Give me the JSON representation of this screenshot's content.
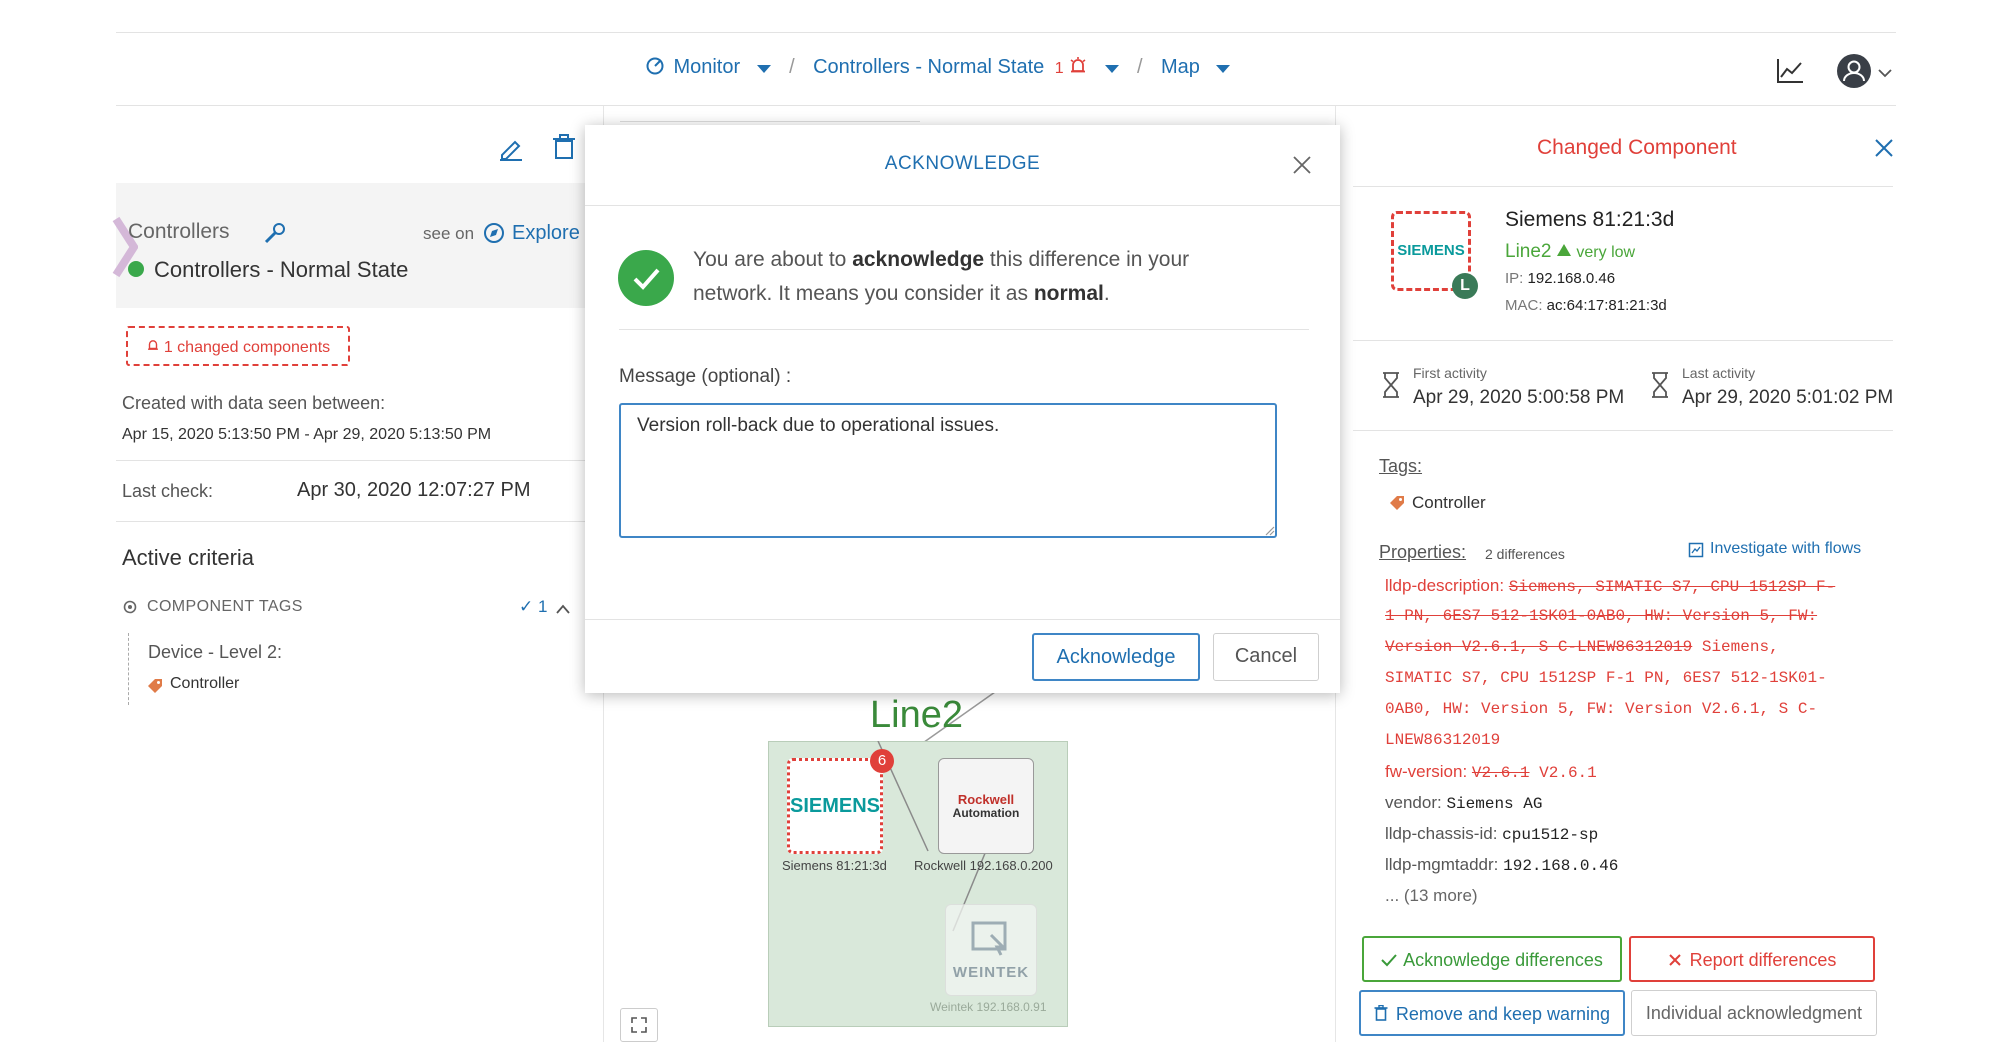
{
  "nav": {
    "monitor": "Monitor",
    "sep1": "/",
    "controllers": "Controllers - Normal State",
    "alert_count": "1",
    "sep2": "/",
    "map": "Map"
  },
  "left": {
    "group_label": "Controllers",
    "see_on": "see on",
    "explore": "Explore",
    "state_name": "Controllers - Normal State",
    "changed_badge": "1 changed components",
    "created_label": "Created with data seen between:",
    "created_range": "Apr 15, 2020 5:13:50 PM - Apr 29, 2020 5:13:50 PM",
    "last_check_label": "Last check:",
    "last_check_value": "Apr 30, 2020 12:07:27 PM",
    "active_criteria": "Active criteria",
    "component_tags": "COMPONENT TAGS",
    "tags_count": "✓ 1",
    "device_level": "Device - Level 2:",
    "tag": "Controller"
  },
  "modal": {
    "title": "ACKNOWLEDGE",
    "msg_pre": "You are about to ",
    "msg_bold1": "acknowledge",
    "msg_mid": " this difference in your network. It means you consider it as ",
    "msg_bold2": "normal",
    "msg_end": ".",
    "message_label": "Message (optional) :",
    "message_value": "Version roll-back due to operational issues.",
    "acknowledge_button": "Acknowledge",
    "cancel_button": "Cancel"
  },
  "map": {
    "line_label": "Line2",
    "siemens_logo": "SIEMENS",
    "siemens_badge": "6",
    "siemens_label": "Siemens 81:21:3d",
    "rockwell_logo_top": "Rockwell",
    "rockwell_logo_bottom": "Automation",
    "rockwell_label": "Rockwell 192.168.0.200",
    "weintek_logo": "WEINTEK",
    "weintek_label": "Weintek 192.168.0.91"
  },
  "right": {
    "title": "Changed Component",
    "device_name": "Siemens 81:21:3d",
    "device_logo": "SIEMENS",
    "device_level_badge": "L",
    "line": "Line2",
    "risk": "very low",
    "ip_label": "IP:",
    "ip": "192.168.0.46",
    "mac_label": "MAC:",
    "mac": "ac:64:17:81:21:3d",
    "first_activity_label": "First activity",
    "first_activity": "Apr 29, 2020 5:00:58 PM",
    "last_activity_label": "Last activity",
    "last_activity": "Apr 29, 2020 5:01:02 PM",
    "tags_label": "Tags:",
    "tag": "Controller",
    "properties_label": "Properties:",
    "differences": "2 differences",
    "investigate": "Investigate with flows",
    "lldp_desc_key": "lldp-description:",
    "lldp_desc_old1": "Siemens, SIMATIC S7, CPU 1512SP F-",
    "lldp_desc_old2": "1 PN, 6ES7 512-1SK01-0AB0, HW: Version 5, FW:",
    "lldp_desc_old3": "Version V2.6.1, S C-LNEW86312019",
    "lldp_desc_new_a": " Siemens,",
    "lldp_desc_new2": "SIMATIC S7, CPU 1512SP F-1 PN, 6ES7 512-1SK01-",
    "lldp_desc_new3": "0AB0, HW: Version 5, FW: Version V2.6.1, S C-",
    "lldp_desc_new4": "LNEW86312019",
    "fw_key": "fw-version:",
    "fw_old": "V2.6.1",
    "fw_new": " V2.6.1",
    "vendor_key": "vendor:",
    "vendor_val": "Siemens AG",
    "chassis_key": "lldp-chassis-id:",
    "chassis_val": "cpu1512-sp",
    "mgmt_key": "lldp-mgmtaddr:",
    "mgmt_val": "192.168.0.46",
    "more": "... (13 more)",
    "ack_diff": "Acknowledge differences",
    "report_diff": "Report differences",
    "remove_keep": "Remove and keep warning",
    "individual_ack": "Individual acknowledgment"
  },
  "colors": {
    "accent": "#1f6fb0",
    "danger": "#e0403a",
    "success": "#3aa84b",
    "map_bg": "#d9e8da"
  }
}
